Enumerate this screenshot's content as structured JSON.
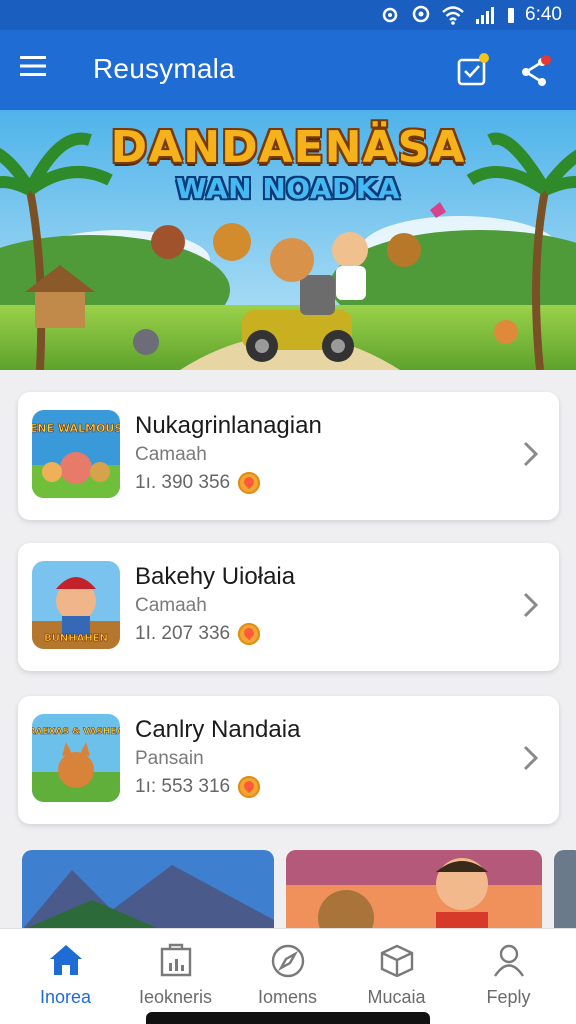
{
  "status_bar": {
    "time": "6:40"
  },
  "app_bar": {
    "title": "Reusymala",
    "icons": [
      "menu-icon",
      "inbox-check-icon",
      "share-icon"
    ]
  },
  "banner": {
    "title_line1": "DANDAENÄSA",
    "title_line2": "WAN NOADKA"
  },
  "cards": [
    {
      "title": "Nukagrinlanagian",
      "subtitle": "Camaah",
      "count": "1ı. 390 356",
      "icon_text": "ENE WALMOUS"
    },
    {
      "title": "Bakehy Uiołaia",
      "subtitle": "Camaah",
      "count": "1I. 207 336",
      "icon_text": "BUNHAHEN"
    },
    {
      "title": "Canlry Nandaia",
      "subtitle": "Pansain",
      "count": "1ı: 553 316",
      "icon_text": "RAEXAS & VASHEA"
    }
  ],
  "bottom_nav": [
    {
      "label": "Inorea",
      "icon": "home-icon",
      "active": true
    },
    {
      "label": "Ieokneris",
      "icon": "bag-icon",
      "active": false
    },
    {
      "label": "Iomens",
      "icon": "compass-icon",
      "active": false
    },
    {
      "label": "Mucaia",
      "icon": "box-icon",
      "active": false
    },
    {
      "label": "Feply",
      "icon": "profile-icon",
      "active": false
    }
  ],
  "colors": {
    "primary": "#1e6cd4",
    "status_bar": "#1a5fc0",
    "background": "#efeff2",
    "accent_badge": "#f5c518",
    "coin": "#f2a631"
  }
}
